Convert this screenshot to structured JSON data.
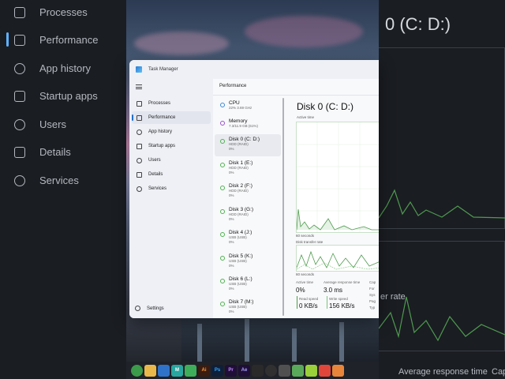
{
  "background_left": {
    "items": [
      {
        "label": "Processes"
      },
      {
        "label": "Performance"
      },
      {
        "label": "App history"
      },
      {
        "label": "Startup apps"
      },
      {
        "label": "Users"
      },
      {
        "label": "Details"
      },
      {
        "label": "Services"
      }
    ]
  },
  "background_right": {
    "title": "0 (C: D:)",
    "transfer_label": "er rate",
    "bottom_labels": [
      "Average response time",
      "Cap"
    ]
  },
  "window": {
    "title": "Task Manager",
    "icon": "task-manager-icon"
  },
  "sidebar": {
    "menu_icon": "hamburger-icon",
    "items": [
      {
        "label": "Processes",
        "icon": "processes-icon",
        "active": false
      },
      {
        "label": "Performance",
        "icon": "performance-icon",
        "active": true
      },
      {
        "label": "App history",
        "icon": "history-icon",
        "active": false
      },
      {
        "label": "Startup apps",
        "icon": "startup-icon",
        "active": false
      },
      {
        "label": "Users",
        "icon": "users-icon",
        "active": false
      },
      {
        "label": "Details",
        "icon": "details-icon",
        "active": false
      },
      {
        "label": "Services",
        "icon": "services-icon",
        "active": false
      }
    ],
    "settings_label": "Settings"
  },
  "main": {
    "title": "Performance",
    "resources": [
      {
        "name": "CPU",
        "sub1": "22%  3.69 GHz",
        "sub2": ""
      },
      {
        "name": "Memory",
        "sub1": "7.3/11.9 GB (61%)",
        "sub2": ""
      },
      {
        "name": "Disk 0 (C: D:)",
        "sub1": "HDD (RAID)",
        "sub2": "0%"
      },
      {
        "name": "Disk 1 (E:)",
        "sub1": "HDD (RAID)",
        "sub2": "0%"
      },
      {
        "name": "Disk 2 (F:)",
        "sub1": "HDD (RAID)",
        "sub2": "0%"
      },
      {
        "name": "Disk 3 (G:)",
        "sub1": "HDD (RAID)",
        "sub2": "0%"
      },
      {
        "name": "Disk 4 (J:)",
        "sub1": "USB (USB)",
        "sub2": "0%"
      },
      {
        "name": "Disk 5 (K:)",
        "sub1": "USB (USB)",
        "sub2": "0%"
      },
      {
        "name": "Disk 6 (L:)",
        "sub1": "USB (USB)",
        "sub2": "0%"
      },
      {
        "name": "Disk 7 (M:)",
        "sub1": "USB (USB)",
        "sub2": "0%"
      }
    ],
    "detail": {
      "title": "Disk 0 (C: D:)",
      "active_time_label": "Active time",
      "seconds_label_1": "60 seconds",
      "transfer_rate_label": "Disk transfer rate",
      "seconds_label_2": "60 seconds",
      "active_time_stat_label": "Active time",
      "active_time_value": "0%",
      "avg_response_label": "Average response time",
      "avg_response_value": "3.0 ms",
      "cap_label": "Cap",
      "read_speed_label": "Read speed",
      "read_speed_value": "0 KB/s",
      "write_speed_label": "Write speed",
      "write_speed_value": "156 KB/s",
      "side_labels": [
        "For",
        "Sys",
        "Pag",
        "Typ"
      ]
    }
  },
  "colors": {
    "accent": "#1f6fd0",
    "disk_green": "#4fb24f",
    "cpu_blue": "#3d8ad8",
    "memory_purple": "#9b4fd0"
  },
  "taskbar": {
    "icons": [
      "chrome-icon",
      "file-explorer-icon",
      "store-icon",
      "app-m-icon",
      "app-check-icon",
      "illustrator-icon",
      "photoshop-icon",
      "premiere-icon",
      "after-effects-icon",
      "resolve-icon",
      "obs-icon",
      "settings-icon",
      "phone-icon",
      "camtasia-icon",
      "capcut-icon",
      "shield-icon"
    ],
    "labels": [
      "",
      "",
      "",
      "M",
      "",
      "Ai",
      "Ps",
      "Pr",
      "Ae",
      "",
      "",
      "",
      "",
      "",
      "",
      ""
    ]
  }
}
